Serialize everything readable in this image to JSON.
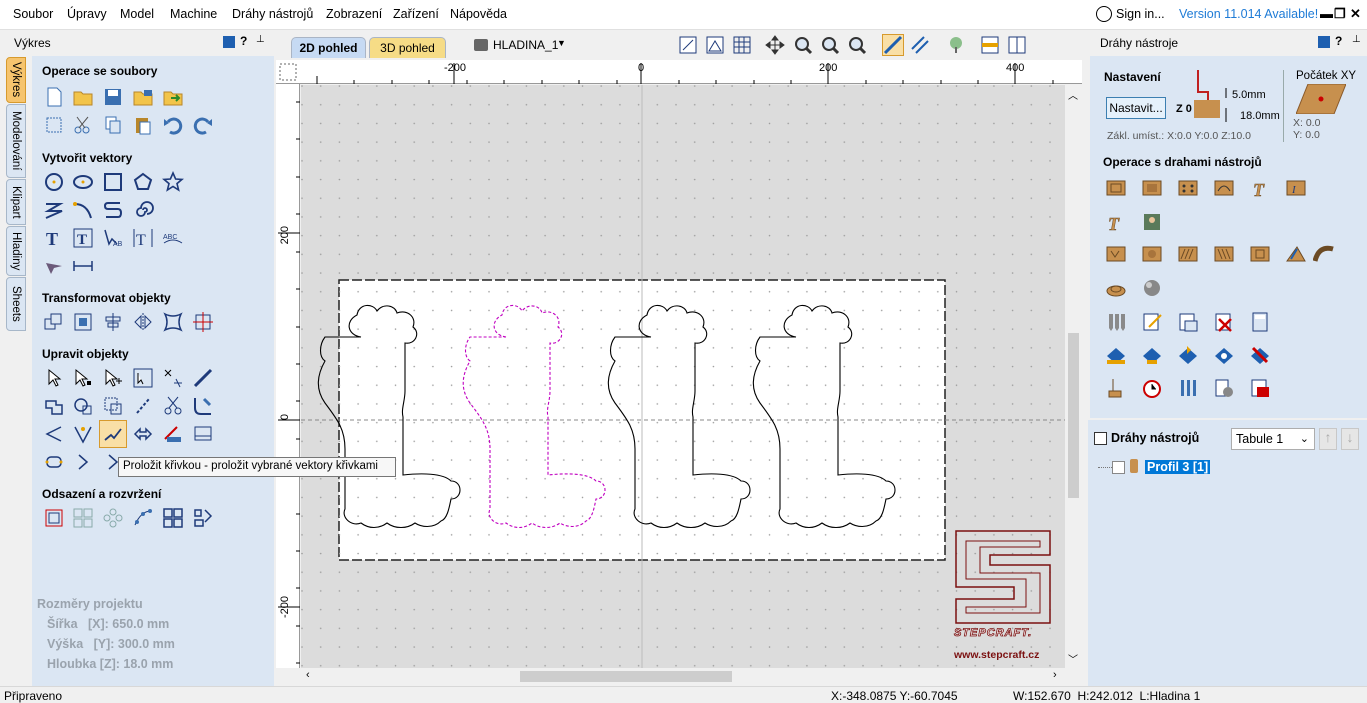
{
  "menu": [
    "Soubor",
    "Úpravy",
    "Model",
    "Machine",
    "Dráhy nástrojů",
    "Zobrazení",
    "Zařízení",
    "Nápověda"
  ],
  "account": {
    "sign_in": "Sign in...",
    "version": "Version 11.014 Available!"
  },
  "window_controls": {
    "minimize": "▬",
    "restore": "❐",
    "close": "✕"
  },
  "left_panel": {
    "title": "Výkres",
    "header_icons": {
      "help": "?",
      "pin": "📌"
    },
    "vtabs": [
      "Výkres",
      "Modelování",
      "Klipart",
      "Hladiny",
      "Sheets"
    ],
    "sections": {
      "file_ops": "Operace se soubory",
      "create_vectors": "Vytvořit vektory",
      "transform": "Transformovat objekty",
      "edit": "Upravit objekty",
      "offset": "Odsazení a rozvržení"
    },
    "project_dims": {
      "title": "Rozměry projektu",
      "width": "Šířka   [X]: 650.0 mm",
      "height": "Výška   [Y]: 300.0 mm",
      "depth": "Hloubka [Z]: 18.0 mm"
    }
  },
  "view_tabs": {
    "tab2d": "2D pohled",
    "tab3d": "3D pohled",
    "layer": "HLADINA_1"
  },
  "rulers": {
    "top": [
      "-200",
      "0",
      "200",
      "400"
    ],
    "left": [
      "200",
      "0",
      "-200"
    ]
  },
  "tooltip": "Proložit křivkou - proložit vybrané vektory křivkami",
  "logo": {
    "name": "STEPCRAFT.",
    "url": "www.stepcraft.cz"
  },
  "right_panel": {
    "title": "Dráhy nástroje",
    "settings_label": "Nastavení",
    "settings_button": "Nastavit...",
    "z0": "Z 0",
    "thick1": "5.0mm",
    "thick2": "18.0mm",
    "origin_title": "Počátek XY",
    "origin_x": "X: 0.0",
    "origin_y": "Y: 0.0",
    "home": "Zákl. umíst.: X:0.0 Y:0.0 Z:10.0",
    "toolpath_ops": "Operace s drahami nástrojů",
    "toolpaths_label": "Dráhy nástrojů",
    "table_select": "Tabule 1",
    "toolpath_item": "Profil 3 [1]"
  },
  "status": {
    "ready": "Připraveno",
    "coords": "X:-348.0875 Y:-60.7045",
    "dims": "W:152.670  H:242.012  L:Hladina 1"
  },
  "colors": {
    "accent": "#1e7bd6",
    "selection": "#c000c0",
    "panel_bg": "#dbe6f3"
  }
}
